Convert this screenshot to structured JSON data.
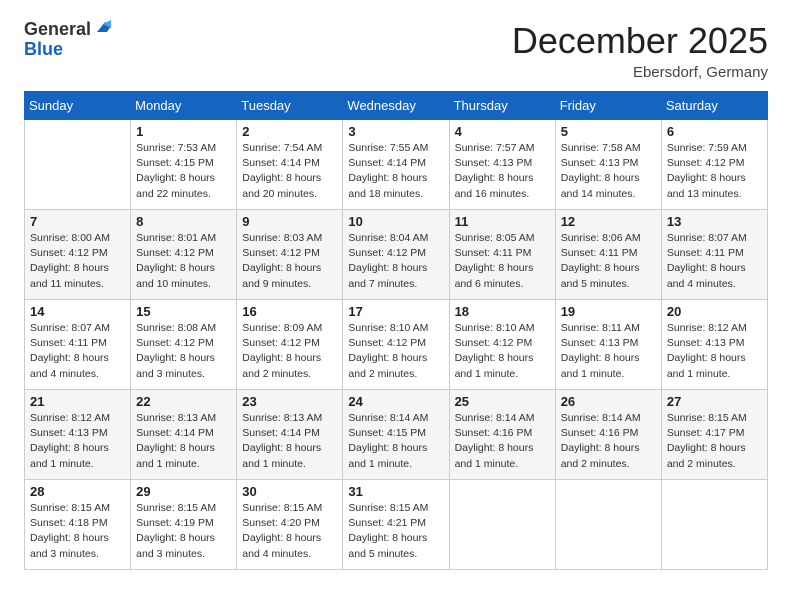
{
  "header": {
    "logo_general": "General",
    "logo_blue": "Blue",
    "month": "December 2025",
    "location": "Ebersdorf, Germany"
  },
  "days_of_week": [
    "Sunday",
    "Monday",
    "Tuesday",
    "Wednesday",
    "Thursday",
    "Friday",
    "Saturday"
  ],
  "weeks": [
    [
      {
        "day": "",
        "sunrise": "",
        "sunset": "",
        "daylight": ""
      },
      {
        "day": "1",
        "sunrise": "Sunrise: 7:53 AM",
        "sunset": "Sunset: 4:15 PM",
        "daylight": "Daylight: 8 hours and 22 minutes."
      },
      {
        "day": "2",
        "sunrise": "Sunrise: 7:54 AM",
        "sunset": "Sunset: 4:14 PM",
        "daylight": "Daylight: 8 hours and 20 minutes."
      },
      {
        "day": "3",
        "sunrise": "Sunrise: 7:55 AM",
        "sunset": "Sunset: 4:14 PM",
        "daylight": "Daylight: 8 hours and 18 minutes."
      },
      {
        "day": "4",
        "sunrise": "Sunrise: 7:57 AM",
        "sunset": "Sunset: 4:13 PM",
        "daylight": "Daylight: 8 hours and 16 minutes."
      },
      {
        "day": "5",
        "sunrise": "Sunrise: 7:58 AM",
        "sunset": "Sunset: 4:13 PM",
        "daylight": "Daylight: 8 hours and 14 minutes."
      },
      {
        "day": "6",
        "sunrise": "Sunrise: 7:59 AM",
        "sunset": "Sunset: 4:12 PM",
        "daylight": "Daylight: 8 hours and 13 minutes."
      }
    ],
    [
      {
        "day": "7",
        "sunrise": "Sunrise: 8:00 AM",
        "sunset": "Sunset: 4:12 PM",
        "daylight": "Daylight: 8 hours and 11 minutes."
      },
      {
        "day": "8",
        "sunrise": "Sunrise: 8:01 AM",
        "sunset": "Sunset: 4:12 PM",
        "daylight": "Daylight: 8 hours and 10 minutes."
      },
      {
        "day": "9",
        "sunrise": "Sunrise: 8:03 AM",
        "sunset": "Sunset: 4:12 PM",
        "daylight": "Daylight: 8 hours and 9 minutes."
      },
      {
        "day": "10",
        "sunrise": "Sunrise: 8:04 AM",
        "sunset": "Sunset: 4:12 PM",
        "daylight": "Daylight: 8 hours and 7 minutes."
      },
      {
        "day": "11",
        "sunrise": "Sunrise: 8:05 AM",
        "sunset": "Sunset: 4:11 PM",
        "daylight": "Daylight: 8 hours and 6 minutes."
      },
      {
        "day": "12",
        "sunrise": "Sunrise: 8:06 AM",
        "sunset": "Sunset: 4:11 PM",
        "daylight": "Daylight: 8 hours and 5 minutes."
      },
      {
        "day": "13",
        "sunrise": "Sunrise: 8:07 AM",
        "sunset": "Sunset: 4:11 PM",
        "daylight": "Daylight: 8 hours and 4 minutes."
      }
    ],
    [
      {
        "day": "14",
        "sunrise": "Sunrise: 8:07 AM",
        "sunset": "Sunset: 4:11 PM",
        "daylight": "Daylight: 8 hours and 4 minutes."
      },
      {
        "day": "15",
        "sunrise": "Sunrise: 8:08 AM",
        "sunset": "Sunset: 4:12 PM",
        "daylight": "Daylight: 8 hours and 3 minutes."
      },
      {
        "day": "16",
        "sunrise": "Sunrise: 8:09 AM",
        "sunset": "Sunset: 4:12 PM",
        "daylight": "Daylight: 8 hours and 2 minutes."
      },
      {
        "day": "17",
        "sunrise": "Sunrise: 8:10 AM",
        "sunset": "Sunset: 4:12 PM",
        "daylight": "Daylight: 8 hours and 2 minutes."
      },
      {
        "day": "18",
        "sunrise": "Sunrise: 8:10 AM",
        "sunset": "Sunset: 4:12 PM",
        "daylight": "Daylight: 8 hours and 1 minute."
      },
      {
        "day": "19",
        "sunrise": "Sunrise: 8:11 AM",
        "sunset": "Sunset: 4:13 PM",
        "daylight": "Daylight: 8 hours and 1 minute."
      },
      {
        "day": "20",
        "sunrise": "Sunrise: 8:12 AM",
        "sunset": "Sunset: 4:13 PM",
        "daylight": "Daylight: 8 hours and 1 minute."
      }
    ],
    [
      {
        "day": "21",
        "sunrise": "Sunrise: 8:12 AM",
        "sunset": "Sunset: 4:13 PM",
        "daylight": "Daylight: 8 hours and 1 minute."
      },
      {
        "day": "22",
        "sunrise": "Sunrise: 8:13 AM",
        "sunset": "Sunset: 4:14 PM",
        "daylight": "Daylight: 8 hours and 1 minute."
      },
      {
        "day": "23",
        "sunrise": "Sunrise: 8:13 AM",
        "sunset": "Sunset: 4:14 PM",
        "daylight": "Daylight: 8 hours and 1 minute."
      },
      {
        "day": "24",
        "sunrise": "Sunrise: 8:14 AM",
        "sunset": "Sunset: 4:15 PM",
        "daylight": "Daylight: 8 hours and 1 minute."
      },
      {
        "day": "25",
        "sunrise": "Sunrise: 8:14 AM",
        "sunset": "Sunset: 4:16 PM",
        "daylight": "Daylight: 8 hours and 1 minute."
      },
      {
        "day": "26",
        "sunrise": "Sunrise: 8:14 AM",
        "sunset": "Sunset: 4:16 PM",
        "daylight": "Daylight: 8 hours and 2 minutes."
      },
      {
        "day": "27",
        "sunrise": "Sunrise: 8:15 AM",
        "sunset": "Sunset: 4:17 PM",
        "daylight": "Daylight: 8 hours and 2 minutes."
      }
    ],
    [
      {
        "day": "28",
        "sunrise": "Sunrise: 8:15 AM",
        "sunset": "Sunset: 4:18 PM",
        "daylight": "Daylight: 8 hours and 3 minutes."
      },
      {
        "day": "29",
        "sunrise": "Sunrise: 8:15 AM",
        "sunset": "Sunset: 4:19 PM",
        "daylight": "Daylight: 8 hours and 3 minutes."
      },
      {
        "day": "30",
        "sunrise": "Sunrise: 8:15 AM",
        "sunset": "Sunset: 4:20 PM",
        "daylight": "Daylight: 8 hours and 4 minutes."
      },
      {
        "day": "31",
        "sunrise": "Sunrise: 8:15 AM",
        "sunset": "Sunset: 4:21 PM",
        "daylight": "Daylight: 8 hours and 5 minutes."
      },
      {
        "day": "",
        "sunrise": "",
        "sunset": "",
        "daylight": ""
      },
      {
        "day": "",
        "sunrise": "",
        "sunset": "",
        "daylight": ""
      },
      {
        "day": "",
        "sunrise": "",
        "sunset": "",
        "daylight": ""
      }
    ]
  ]
}
